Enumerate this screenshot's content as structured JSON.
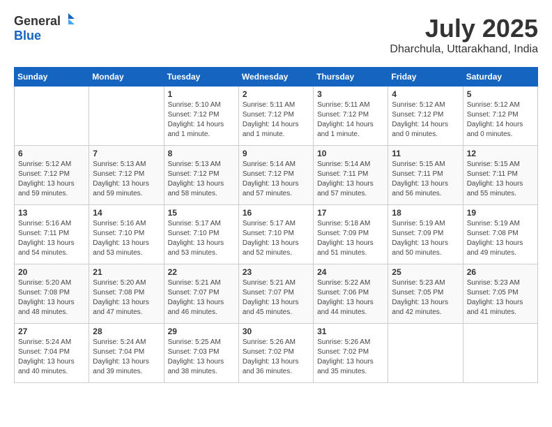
{
  "header": {
    "logo_general": "General",
    "logo_blue": "Blue",
    "month_year": "July 2025",
    "location": "Dharchula, Uttarakhand, India"
  },
  "calendar": {
    "days_of_week": [
      "Sunday",
      "Monday",
      "Tuesday",
      "Wednesday",
      "Thursday",
      "Friday",
      "Saturday"
    ],
    "weeks": [
      [
        {
          "day": "",
          "info": ""
        },
        {
          "day": "",
          "info": ""
        },
        {
          "day": "1",
          "info": "Sunrise: 5:10 AM\nSunset: 7:12 PM\nDaylight: 14 hours\nand 1 minute."
        },
        {
          "day": "2",
          "info": "Sunrise: 5:11 AM\nSunset: 7:12 PM\nDaylight: 14 hours\nand 1 minute."
        },
        {
          "day": "3",
          "info": "Sunrise: 5:11 AM\nSunset: 7:12 PM\nDaylight: 14 hours\nand 1 minute."
        },
        {
          "day": "4",
          "info": "Sunrise: 5:12 AM\nSunset: 7:12 PM\nDaylight: 14 hours\nand 0 minutes."
        },
        {
          "day": "5",
          "info": "Sunrise: 5:12 AM\nSunset: 7:12 PM\nDaylight: 14 hours\nand 0 minutes."
        }
      ],
      [
        {
          "day": "6",
          "info": "Sunrise: 5:12 AM\nSunset: 7:12 PM\nDaylight: 13 hours\nand 59 minutes."
        },
        {
          "day": "7",
          "info": "Sunrise: 5:13 AM\nSunset: 7:12 PM\nDaylight: 13 hours\nand 59 minutes."
        },
        {
          "day": "8",
          "info": "Sunrise: 5:13 AM\nSunset: 7:12 PM\nDaylight: 13 hours\nand 58 minutes."
        },
        {
          "day": "9",
          "info": "Sunrise: 5:14 AM\nSunset: 7:12 PM\nDaylight: 13 hours\nand 57 minutes."
        },
        {
          "day": "10",
          "info": "Sunrise: 5:14 AM\nSunset: 7:11 PM\nDaylight: 13 hours\nand 57 minutes."
        },
        {
          "day": "11",
          "info": "Sunrise: 5:15 AM\nSunset: 7:11 PM\nDaylight: 13 hours\nand 56 minutes."
        },
        {
          "day": "12",
          "info": "Sunrise: 5:15 AM\nSunset: 7:11 PM\nDaylight: 13 hours\nand 55 minutes."
        }
      ],
      [
        {
          "day": "13",
          "info": "Sunrise: 5:16 AM\nSunset: 7:11 PM\nDaylight: 13 hours\nand 54 minutes."
        },
        {
          "day": "14",
          "info": "Sunrise: 5:16 AM\nSunset: 7:10 PM\nDaylight: 13 hours\nand 53 minutes."
        },
        {
          "day": "15",
          "info": "Sunrise: 5:17 AM\nSunset: 7:10 PM\nDaylight: 13 hours\nand 53 minutes."
        },
        {
          "day": "16",
          "info": "Sunrise: 5:17 AM\nSunset: 7:10 PM\nDaylight: 13 hours\nand 52 minutes."
        },
        {
          "day": "17",
          "info": "Sunrise: 5:18 AM\nSunset: 7:09 PM\nDaylight: 13 hours\nand 51 minutes."
        },
        {
          "day": "18",
          "info": "Sunrise: 5:19 AM\nSunset: 7:09 PM\nDaylight: 13 hours\nand 50 minutes."
        },
        {
          "day": "19",
          "info": "Sunrise: 5:19 AM\nSunset: 7:08 PM\nDaylight: 13 hours\nand 49 minutes."
        }
      ],
      [
        {
          "day": "20",
          "info": "Sunrise: 5:20 AM\nSunset: 7:08 PM\nDaylight: 13 hours\nand 48 minutes."
        },
        {
          "day": "21",
          "info": "Sunrise: 5:20 AM\nSunset: 7:08 PM\nDaylight: 13 hours\nand 47 minutes."
        },
        {
          "day": "22",
          "info": "Sunrise: 5:21 AM\nSunset: 7:07 PM\nDaylight: 13 hours\nand 46 minutes."
        },
        {
          "day": "23",
          "info": "Sunrise: 5:21 AM\nSunset: 7:07 PM\nDaylight: 13 hours\nand 45 minutes."
        },
        {
          "day": "24",
          "info": "Sunrise: 5:22 AM\nSunset: 7:06 PM\nDaylight: 13 hours\nand 44 minutes."
        },
        {
          "day": "25",
          "info": "Sunrise: 5:23 AM\nSunset: 7:05 PM\nDaylight: 13 hours\nand 42 minutes."
        },
        {
          "day": "26",
          "info": "Sunrise: 5:23 AM\nSunset: 7:05 PM\nDaylight: 13 hours\nand 41 minutes."
        }
      ],
      [
        {
          "day": "27",
          "info": "Sunrise: 5:24 AM\nSunset: 7:04 PM\nDaylight: 13 hours\nand 40 minutes."
        },
        {
          "day": "28",
          "info": "Sunrise: 5:24 AM\nSunset: 7:04 PM\nDaylight: 13 hours\nand 39 minutes."
        },
        {
          "day": "29",
          "info": "Sunrise: 5:25 AM\nSunset: 7:03 PM\nDaylight: 13 hours\nand 38 minutes."
        },
        {
          "day": "30",
          "info": "Sunrise: 5:26 AM\nSunset: 7:02 PM\nDaylight: 13 hours\nand 36 minutes."
        },
        {
          "day": "31",
          "info": "Sunrise: 5:26 AM\nSunset: 7:02 PM\nDaylight: 13 hours\nand 35 minutes."
        },
        {
          "day": "",
          "info": ""
        },
        {
          "day": "",
          "info": ""
        }
      ]
    ]
  }
}
